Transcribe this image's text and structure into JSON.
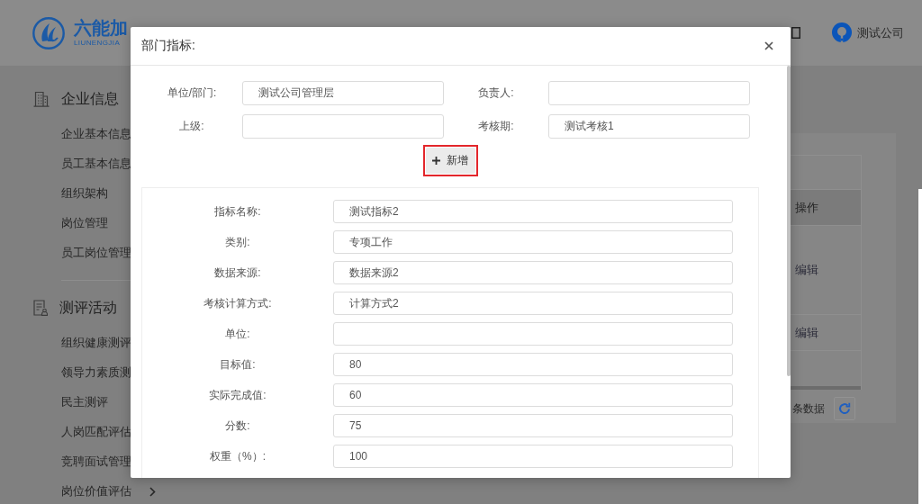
{
  "header": {
    "logo": {
      "name": "六能加",
      "subtitle": "LIUNENGJIA"
    },
    "user": {
      "name": "测试公司"
    }
  },
  "sidebar": {
    "sections": [
      {
        "title": "企业信息",
        "items": [
          {
            "label": "企业基本信息",
            "has_submenu": false
          },
          {
            "label": "员工基本信息",
            "has_submenu": false
          },
          {
            "label": "组织架构",
            "has_submenu": false
          },
          {
            "label": "岗位管理",
            "has_submenu": false
          },
          {
            "label": "员工岗位管理",
            "has_submenu": false
          }
        ]
      },
      {
        "title": "测评活动",
        "items": [
          {
            "label": "组织健康测评",
            "has_submenu": false
          },
          {
            "label": "领导力素质测",
            "has_submenu": false
          },
          {
            "label": "民主测评",
            "has_submenu": false
          },
          {
            "label": "人岗匹配评估",
            "has_submenu": false
          },
          {
            "label": "竞聘面试管理",
            "has_submenu": false
          },
          {
            "label": "岗位价值评估",
            "has_submenu": true
          }
        ]
      }
    ]
  },
  "table": {
    "columns": [
      "操作"
    ],
    "rows": [
      {
        "action": "编辑"
      },
      {
        "action": "编辑"
      }
    ],
    "footer": {
      "count_text": "条数据"
    }
  },
  "dialog": {
    "title": "部门指标:",
    "fields": [
      {
        "label": "单位/部门:",
        "value": "测试公司管理层"
      },
      {
        "label": "负责人:"
      },
      {
        "label": "上级:"
      },
      {
        "label": "考核期:",
        "value": "测试考核1"
      }
    ],
    "add_button": {
      "label": "新增",
      "highlighted": true
    },
    "indicator_fields": [
      {
        "label": "指标名称:",
        "value": "测试指标2"
      },
      {
        "label": "类别:",
        "value": "专项工作"
      },
      {
        "label": "数据来源:",
        "value": "数据来源2"
      },
      {
        "label": "考核计算方式:",
        "value": "计算方式2"
      },
      {
        "label": "单位:"
      },
      {
        "label": "目标值:",
        "value": "80"
      },
      {
        "label": "实际完成值:",
        "value": "60"
      },
      {
        "label": "分数:",
        "value": "75"
      },
      {
        "label": "权重（%）:",
        "value": "100"
      }
    ]
  }
}
